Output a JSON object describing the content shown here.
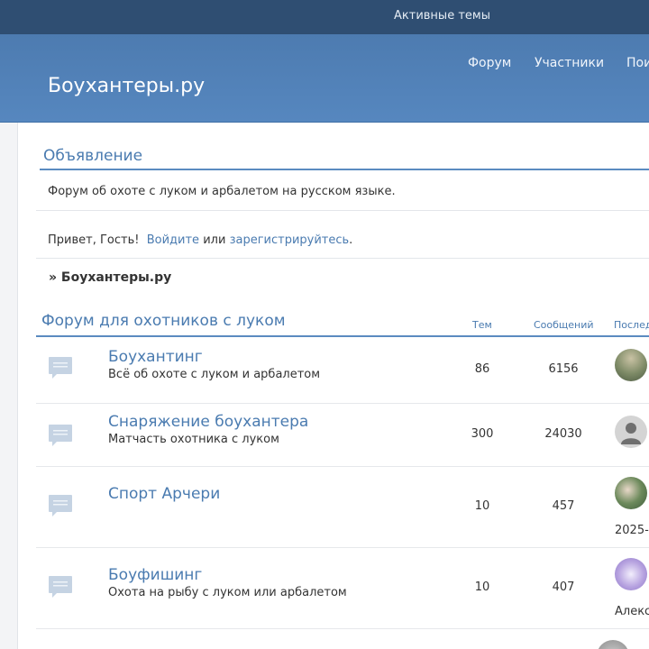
{
  "topbar": {
    "active_topics": "Активные темы"
  },
  "header": {
    "site_title": "Боухантеры.ру",
    "nav": [
      "Форум",
      "Участники",
      "Пои"
    ]
  },
  "announcement": {
    "title": "Объявление",
    "text": "Форум об охоте с луком и арбалетом на русском языке."
  },
  "welcome": {
    "greeting": "Привет, Гость!",
    "login": "Войдите",
    "or": "или",
    "register": "зарегистрируйтесь",
    "period": "."
  },
  "breadcrumb": "» Боухантеры.ру",
  "category": {
    "title": "Форум для охотников с луком",
    "columns": {
      "topics": "Тем",
      "posts": "Сообщений",
      "last": "Послед"
    }
  },
  "forums": [
    {
      "name": "Боухантинг",
      "desc": "Всё об охоте с луком и арбалетом",
      "topics": "86",
      "posts": "6156",
      "last_text": ""
    },
    {
      "name": "Снаряжение боухантера",
      "desc": "Матчасть охотника с луком",
      "topics": "300",
      "posts": "24030",
      "last_text": ""
    },
    {
      "name": "Спорт Арчери",
      "desc": "",
      "topics": "10",
      "posts": "457",
      "last_text": "2025-"
    },
    {
      "name": "Боуфишинг",
      "desc": "Охота на рыбу с луком или арбалетом",
      "topics": "10",
      "posts": "407",
      "last_text": "Алекс"
    }
  ],
  "colors": {
    "topbar": "#2f4e72",
    "header": "#5687bf",
    "link": "#4a7bb0"
  }
}
